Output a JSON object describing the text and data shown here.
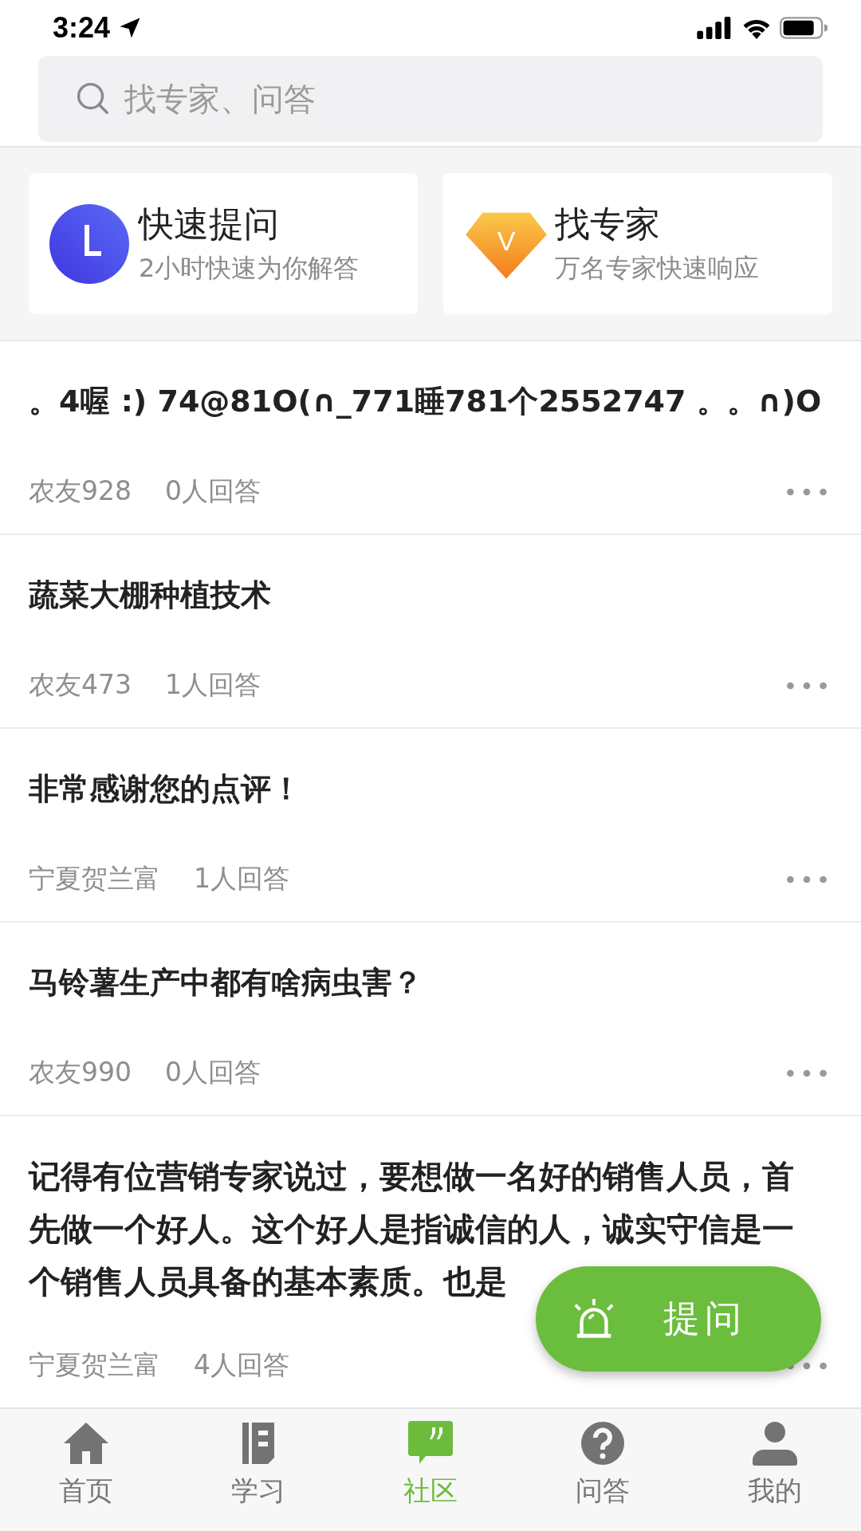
{
  "status_bar": {
    "time": "3:24"
  },
  "search": {
    "placeholder": "找专家、问答"
  },
  "shortcuts": [
    {
      "kind": "clock",
      "title": "快速提问",
      "subtitle": "2小时快速为你解答"
    },
    {
      "kind": "diamond",
      "badge": "V",
      "title": "找专家",
      "subtitle": "万名专家快速响应"
    }
  ],
  "posts": [
    {
      "title": "。4喔 :) 74@81O(∩_771睡781个2552747 。。∩)O",
      "author": "农友928",
      "answers": "0人回答"
    },
    {
      "title": "蔬菜大棚种植技术",
      "author": "农友473",
      "answers": "1人回答"
    },
    {
      "title": "非常感谢您的点评！",
      "author": "宁夏贺兰富",
      "answers": "1人回答"
    },
    {
      "title": "马铃薯生产中都有啥病虫害？",
      "author": "农友990",
      "answers": "0人回答"
    },
    {
      "title_lines": [
        "记得有位营销专家说过，要想做一名好的销售人员，首",
        "先做一个好人。这个好人是指诚信的人，诚实守信是一",
        "个销售人员具备的基本素质。也是"
      ],
      "author": "宁夏贺兰富",
      "answers": "4人回答"
    }
  ],
  "fab": {
    "label": "提问"
  },
  "tabs": [
    {
      "kind": "home",
      "label": "首页",
      "selected": false
    },
    {
      "kind": "book",
      "label": "学习",
      "selected": false
    },
    {
      "kind": "chat",
      "label": "社区",
      "selected": true
    },
    {
      "kind": "question",
      "label": "问答",
      "selected": false
    },
    {
      "kind": "person",
      "label": "我的",
      "selected": false
    }
  ]
}
